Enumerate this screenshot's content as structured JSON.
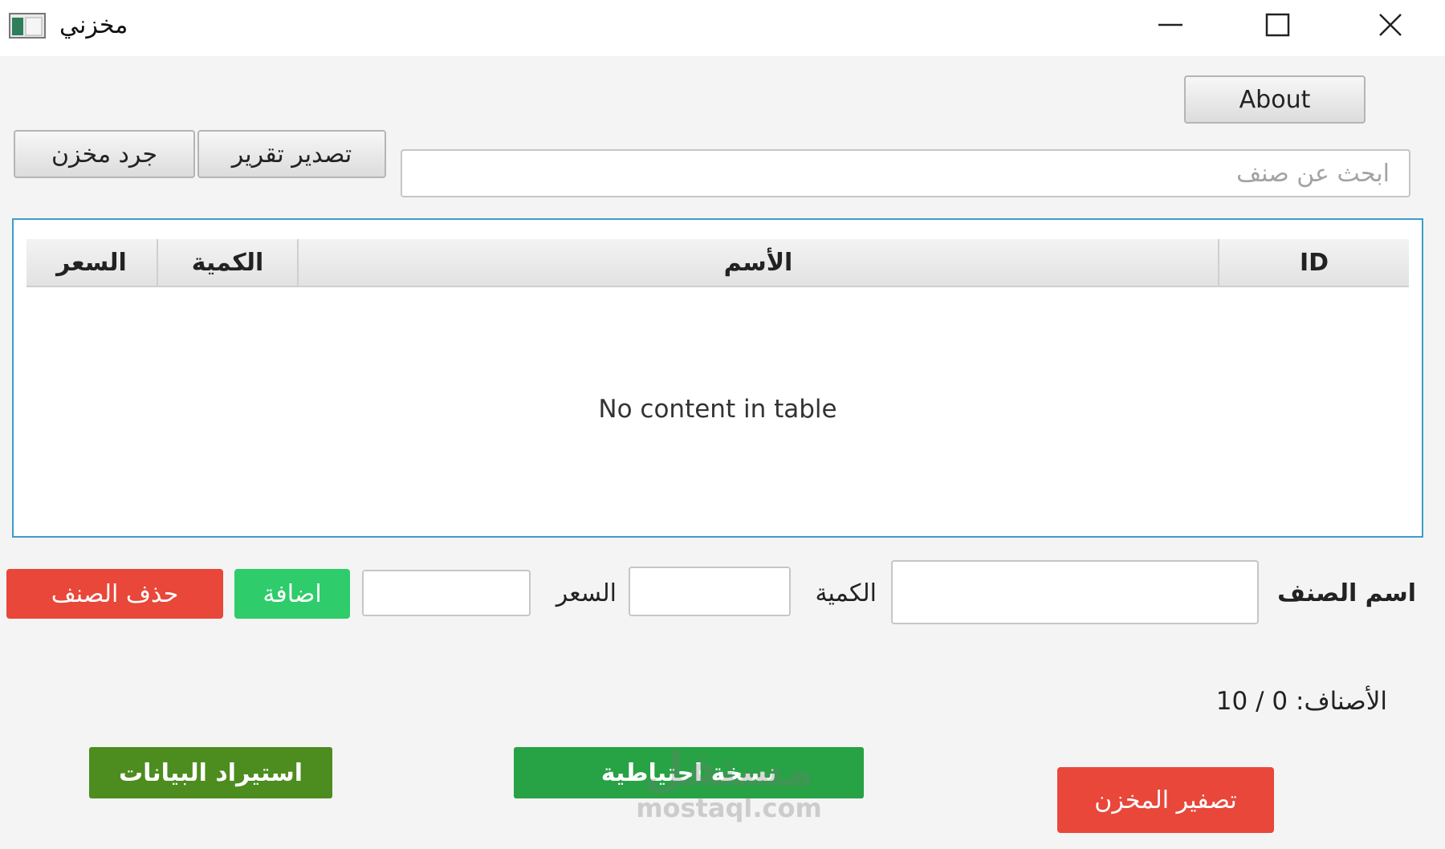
{
  "window": {
    "title": "مخزني",
    "icon": "app-window-icon",
    "controls": {
      "minimize": "minimize-icon",
      "maximize": "maximize-icon",
      "close": "close-icon"
    }
  },
  "toolbar": {
    "about_label": "About",
    "export_report_label": "تصدير تقرير",
    "inventory_count_label": "جرد مخزن"
  },
  "search": {
    "placeholder": "ابحث عن صنف",
    "value": ""
  },
  "table": {
    "columns": [
      "ID",
      "الأسم",
      "الكمية",
      "السعر"
    ],
    "empty_message": "No content in table",
    "rows": []
  },
  "form": {
    "name_label": "اسم الصنف",
    "name_value": "",
    "quantity_label": "الكمية",
    "quantity_value": "",
    "price_label": "السعر",
    "price_value": "",
    "add_label": "اضافة",
    "delete_label": "حذف الصنف"
  },
  "stats": {
    "items_count_text": "الأصناف: 0 / 10"
  },
  "actions": {
    "restore_label": "استيراد البيانات",
    "backup_label": "نسخة احتياطية",
    "reset_label": "تصفير المخزن"
  },
  "watermark": {
    "logo_text": "مستقل",
    "url": "mostaql.com"
  },
  "colors": {
    "accent_border": "#3b9ec9",
    "delete": "#e8473a",
    "add": "#2fcc6b",
    "restore": "#4d8c1f",
    "backup": "#27a245",
    "reset": "#e8473a"
  }
}
